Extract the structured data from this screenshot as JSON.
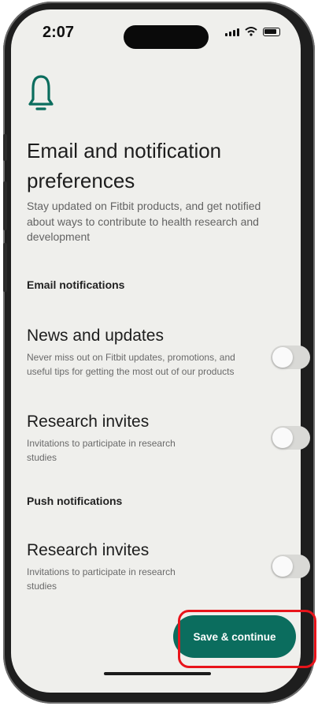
{
  "status_bar": {
    "time": "2:07"
  },
  "header": {
    "icon": "bell-icon",
    "title": "Email and notification preferences",
    "subtitle": "Stay updated on Fitbit products, and get notified about ways to contribute to health research and development"
  },
  "email_section": {
    "heading": "Email notifications",
    "items": [
      {
        "title": "News and updates",
        "description": "Never miss out on Fitbit updates, promotions, and useful tips for getting the most out of our products",
        "enabled": false
      },
      {
        "title": "Research invites",
        "description": "Invitations to participate in research studies",
        "enabled": false
      }
    ]
  },
  "push_section": {
    "heading": "Push notifications",
    "items": [
      {
        "title": "Research invites",
        "description": "Invitations to participate in research studies",
        "enabled": false
      }
    ]
  },
  "actions": {
    "save_label": "Save & continue"
  },
  "colors": {
    "accent": "#0b6d5e",
    "highlight": "#e8141b",
    "background": "#efefec"
  }
}
